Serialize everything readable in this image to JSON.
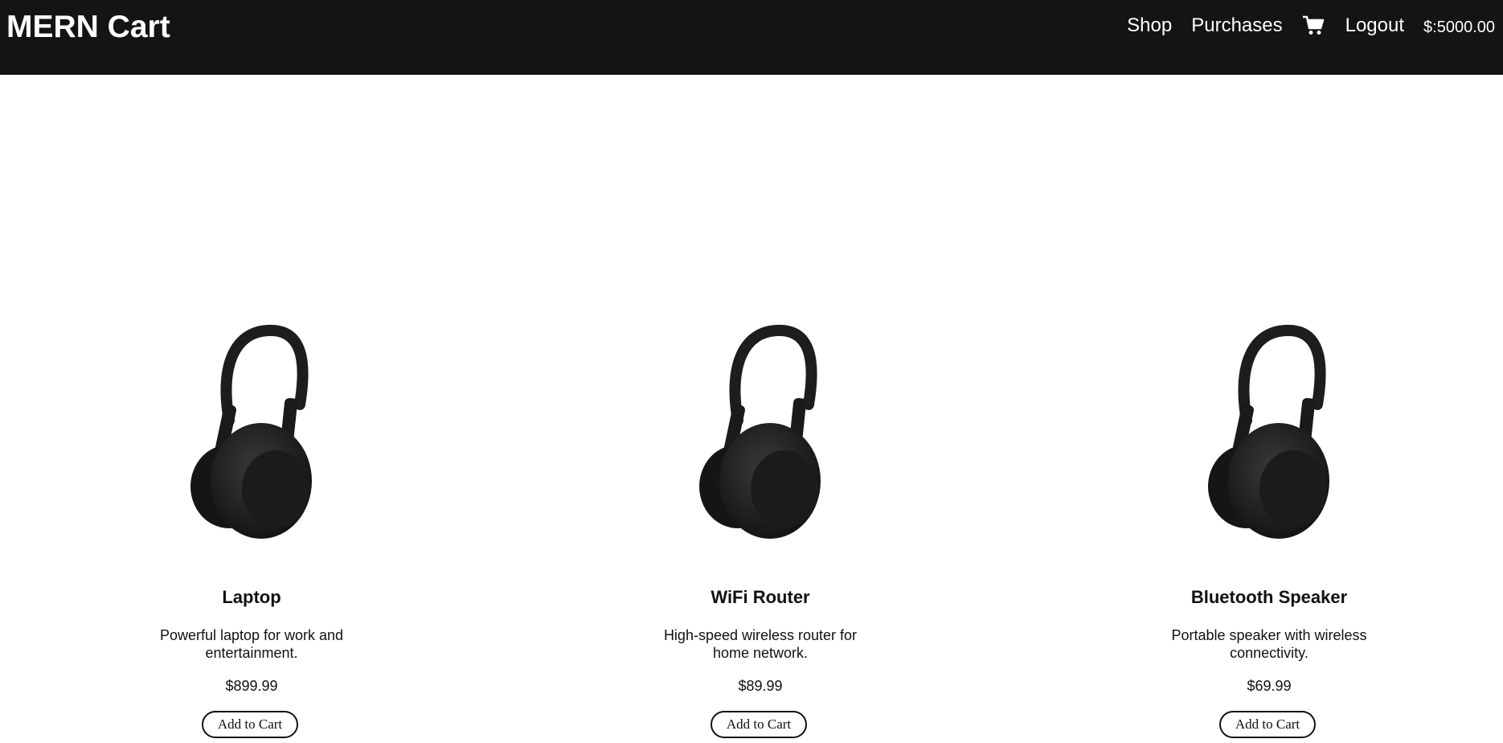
{
  "navbar": {
    "brand": "MERN Cart",
    "links": {
      "shop": "Shop",
      "purchases": "Purchases",
      "logout": "Logout"
    },
    "cart_icon": "shopping-cart-icon",
    "balance": "$:5000.00"
  },
  "products": [
    {
      "name": "Laptop",
      "description": "Powerful laptop for work and entertainment.",
      "price": "$899.99",
      "button_label": "Add to Cart",
      "image_icon": "headphones-image"
    },
    {
      "name": "WiFi Router",
      "description": "High-speed wireless router for home network.",
      "price": "$89.99",
      "button_label": "Add to Cart",
      "image_icon": "headphones-image"
    },
    {
      "name": "Bluetooth Speaker",
      "description": "Portable speaker with wireless connectivity.",
      "price": "$69.99",
      "button_label": "Add to Cart",
      "image_icon": "headphones-image"
    }
  ],
  "colors": {
    "navbar_bg": "#141414",
    "navbar_text": "#ffffff",
    "page_bg": "#ffffff"
  }
}
